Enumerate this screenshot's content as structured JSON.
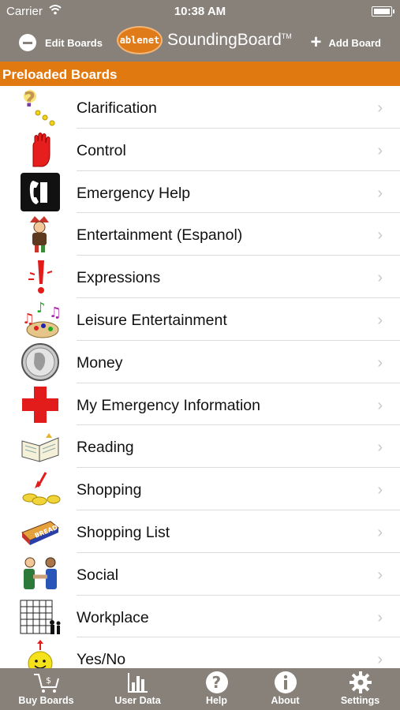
{
  "status_bar": {
    "carrier": "Carrier",
    "time": "10:38 AM"
  },
  "nav": {
    "edit_label": "Edit Boards",
    "brand_logo": "ablenet",
    "brand_name": "SoundingBoard",
    "brand_tm": "TM",
    "add_label": "Add Board"
  },
  "section": {
    "title": "Preloaded Boards"
  },
  "boards": [
    {
      "label": "Clarification",
      "icon": "question-dots-icon"
    },
    {
      "label": "Control",
      "icon": "stop-hand-icon"
    },
    {
      "label": "Emergency Help",
      "icon": "telephone-icon"
    },
    {
      "label": "Entertainment (Espanol)",
      "icon": "jester-icon"
    },
    {
      "label": "Expressions",
      "icon": "exclamation-icon"
    },
    {
      "label": "Leisure Entertainment",
      "icon": "music-palette-icon"
    },
    {
      "label": "Money",
      "icon": "coin-icon"
    },
    {
      "label": "My Emergency Information",
      "icon": "red-cross-icon"
    },
    {
      "label": "Reading",
      "icon": "open-book-icon"
    },
    {
      "label": "Shopping",
      "icon": "coins-arrow-icon"
    },
    {
      "label": "Shopping List",
      "icon": "bread-icon"
    },
    {
      "label": "Social",
      "icon": "handshake-icon"
    },
    {
      "label": "Workplace",
      "icon": "office-building-icon"
    },
    {
      "label": "Yes/No",
      "icon": "smiley-icon"
    }
  ],
  "tabs": [
    {
      "label": "Buy Boards",
      "icon": "cart-icon"
    },
    {
      "label": "User Data",
      "icon": "bar-chart-icon"
    },
    {
      "label": "Help",
      "icon": "help-icon"
    },
    {
      "label": "About",
      "icon": "info-icon"
    },
    {
      "label": "Settings",
      "icon": "gear-icon"
    }
  ]
}
